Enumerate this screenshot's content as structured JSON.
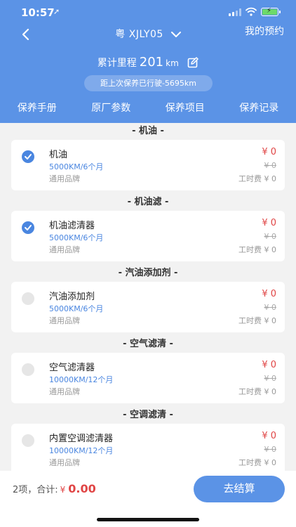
{
  "status_bar": {
    "time": "10:57",
    "location_glyph": "➚"
  },
  "nav": {
    "plate": "粤 XJLY05",
    "appointments": "我的预约"
  },
  "mileage": {
    "label": "累计里程",
    "value": "201",
    "unit": "km"
  },
  "since_service": "距上次保养已行驶-5695km",
  "tabs": [
    "保养手册",
    "原厂参数",
    "保养项目",
    "保养记录"
  ],
  "sections": [
    {
      "title": "- 机油 -",
      "item": {
        "name": "机油",
        "interval": "5000KM/6个月",
        "brand": "通用品牌",
        "price": "¥ 0",
        "original": "¥ 0",
        "labor": "工时费 ¥ 0",
        "checked": true
      }
    },
    {
      "title": "- 机油滤 -",
      "item": {
        "name": "机油滤清器",
        "interval": "5000KM/6个月",
        "brand": "通用品牌",
        "price": "¥ 0",
        "original": "¥ 0",
        "labor": "工时费 ¥ 0",
        "checked": true
      }
    },
    {
      "title": "- 汽油添加剂 -",
      "item": {
        "name": "汽油添加剂",
        "interval": "5000KM/6个月",
        "brand": "通用品牌",
        "price": "¥ 0",
        "original": "¥ 0",
        "labor": "工时费 ¥ 0",
        "checked": false
      }
    },
    {
      "title": "- 空气滤清 -",
      "item": {
        "name": "空气滤清器",
        "interval": "10000KM/12个月",
        "brand": "通用品牌",
        "price": "¥ 0",
        "original": "¥ 0",
        "labor": "工时费 ¥ 0",
        "checked": false
      }
    },
    {
      "title": "- 空调滤清 -",
      "item": {
        "name": "内置空调滤清器",
        "interval": "10000KM/12个月",
        "brand": "通用品牌",
        "price": "¥ 0",
        "original": "¥ 0",
        "labor": "工时费 ¥ 0",
        "checked": false
      }
    }
  ],
  "footer": {
    "summary": "2项，合计:",
    "currency": "¥",
    "amount": "0.00",
    "checkout": "去结算"
  },
  "colors": {
    "primary": "#5b93e6",
    "price_red": "#e04545",
    "check_blue": "#4a86e0"
  }
}
